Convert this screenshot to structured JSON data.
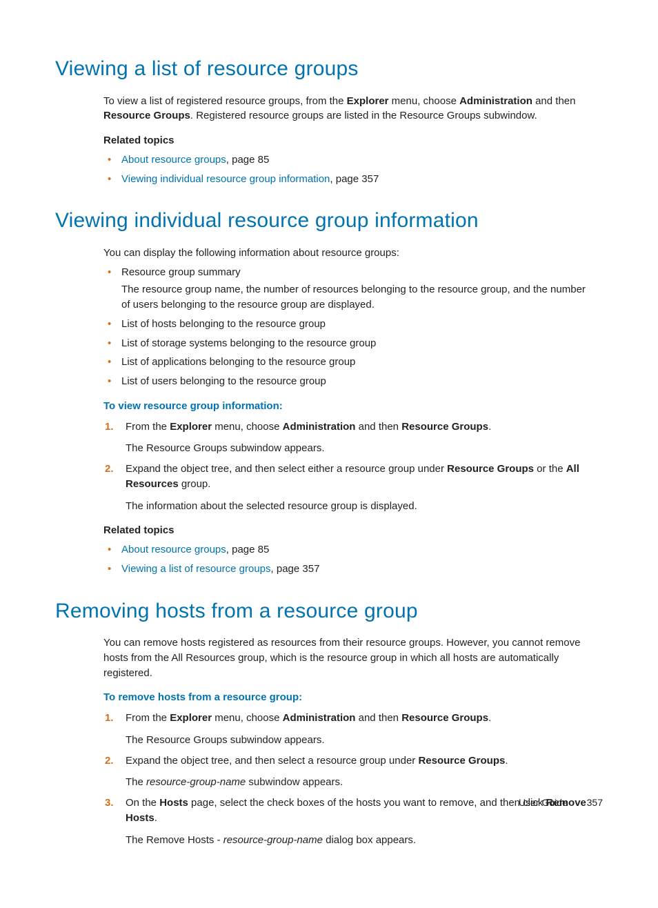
{
  "sections": {
    "s1": {
      "heading": "Viewing a list of resource groups",
      "intro_pre": "To view a list of registered resource groups, from the ",
      "intro_b1": "Explorer",
      "intro_mid1": " menu, choose ",
      "intro_b2": "Administration",
      "intro_mid2": " and then ",
      "intro_b3": "Resource Groups",
      "intro_post": ". Registered resource groups are listed in the Resource Groups subwindow.",
      "related_label": "Related topics",
      "rel1_link": "About resource groups",
      "rel1_tail": ", page 85",
      "rel2_link": "Viewing individual resource group information",
      "rel2_tail": ", page 357"
    },
    "s2": {
      "heading": "Viewing individual resource group information",
      "intro": "You can display the following information about resource groups:",
      "b1_title": "Resource group summary",
      "b1_desc": "The resource group name, the number of resources belonging to the resource group, and the number of users belonging to the resource group are displayed.",
      "b2": "List of hosts belonging to the resource group",
      "b3": "List of storage systems belonging to the resource group",
      "b4": "List of applications belonging to the resource group",
      "b5": "List of users belonging to the resource group",
      "proc_label": "To view resource group information:",
      "step1_pre": "From the ",
      "step1_b1": "Explorer",
      "step1_mid1": " menu, choose ",
      "step1_b2": "Administration",
      "step1_mid2": " and then ",
      "step1_b3": "Resource Groups",
      "step1_post": ".",
      "step1_sub": "The Resource Groups subwindow appears.",
      "step2_pre": "Expand the object tree, and then select either a resource group under ",
      "step2_b1": "Resource Groups",
      "step2_mid1": " or the ",
      "step2_b2": "All Resources",
      "step2_post": " group.",
      "step2_sub": "The information about the selected resource group is displayed.",
      "related_label": "Related topics",
      "rel1_link": "About resource groups",
      "rel1_tail": ", page 85",
      "rel2_link": "Viewing a list of resource groups",
      "rel2_tail": ", page 357"
    },
    "s3": {
      "heading": "Removing hosts from a resource group",
      "intro": "You can remove hosts registered as resources from their resource groups. However, you cannot remove hosts from the All Resources group, which is the resource group in which all hosts are automatically registered.",
      "proc_label": "To remove hosts from a resource group:",
      "step1_pre": "From the ",
      "step1_b1": "Explorer",
      "step1_mid1": " menu, choose ",
      "step1_b2": "Administration",
      "step1_mid2": " and then ",
      "step1_b3": "Resource Groups",
      "step1_post": ".",
      "step1_sub": "The Resource Groups subwindow appears.",
      "step2_pre": "Expand the object tree, and then select a resource group under ",
      "step2_b1": "Resource Groups",
      "step2_post": ".",
      "step2_sub_pre": "The ",
      "step2_sub_var": "resource-group-name",
      "step2_sub_post": " subwindow appears.",
      "step3_pre": "On the ",
      "step3_b1": "Hosts",
      "step3_mid1": " page, select the check boxes of the hosts you want to remove, and then click ",
      "step3_b2": "Remove Hosts",
      "step3_post": ".",
      "step3_sub_pre": "The Remove Hosts - ",
      "step3_sub_var": "resource-group-name",
      "step3_sub_post": " dialog box appears."
    }
  },
  "footer": {
    "label": "User Guide",
    "page": "357"
  }
}
